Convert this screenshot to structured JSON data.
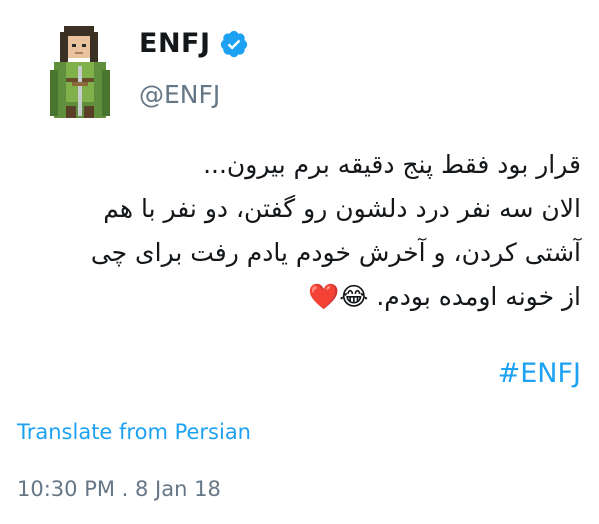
{
  "author": {
    "display_name": "ENFJ",
    "handle": "@ENFJ",
    "verified": true
  },
  "tweet": {
    "lines": [
      "قرار بود فقط پنج دقیقه برم بیرون...",
      "الان سه نفر درد دلشون رو گفتن، دو نفر با هم",
      "آشتی کردن، و آخرش خودم یادم رفت برای چی",
      "از خونه اومده بودم. 😂❤️"
    ],
    "hashtag": "ENFJ#"
  },
  "actions": {
    "translate_label": "Translate from Persian"
  },
  "meta": {
    "timestamp": "10:30 PM . 8 Jan 18"
  },
  "colors": {
    "accent": "#1da1f2",
    "secondary_text": "#657786",
    "primary_text": "#14171a"
  },
  "icons": {
    "avatar": "pixel-elf-character-avatar",
    "verified": "verified-badge-icon"
  }
}
